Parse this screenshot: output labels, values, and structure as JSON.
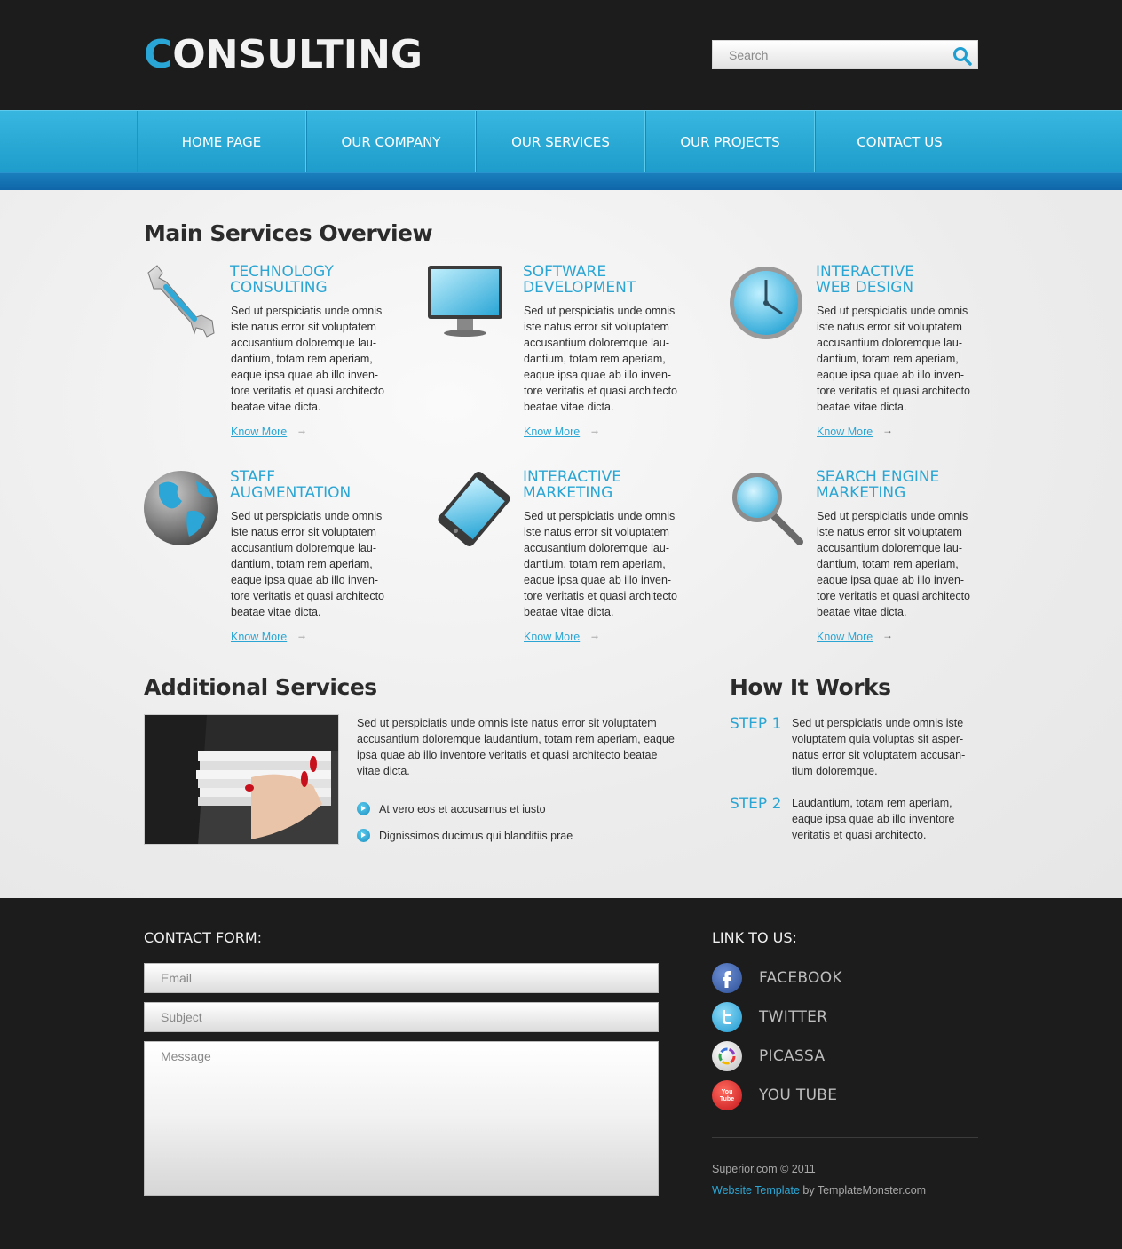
{
  "header": {
    "logo_first": "C",
    "logo_rest": "ONSULTING",
    "search_placeholder": "Search"
  },
  "nav": {
    "items": [
      "HOME PAGE",
      "OUR COMPANY",
      "OUR SERVICES",
      "OUR PROJECTS",
      "CONTACT US"
    ]
  },
  "main_services": {
    "title": "Main Services Overview",
    "know_more": "Know More",
    "arrow": "→",
    "items": [
      {
        "title1": "TECHNOLOGY",
        "title2": "CONSULTING",
        "icon": "wrench-icon"
      },
      {
        "title1": "SOFTWARE",
        "title2": "DEVELOPMENT",
        "icon": "monitor-icon"
      },
      {
        "title1": "INTERACTIVE",
        "title2": "WEB DESIGN",
        "icon": "clock-icon"
      },
      {
        "title1": "STAFF",
        "title2": "AUGMENTATION",
        "icon": "globe-icon"
      },
      {
        "title1": "INTERACTIVE",
        "title2": "MARKETING",
        "icon": "tablet-icon"
      },
      {
        "title1": "SEARCH ENGINE",
        "title2": "MARKETING",
        "icon": "magnifier-icon"
      }
    ],
    "body_lines": [
      "Sed ut perspiciatis unde omnis",
      "iste natus error sit voluptatem",
      "accusantium doloremque lau-",
      "dantium, totam rem aperiam,",
      "eaque ipsa quae ab illo inven-",
      "tore veritatis et quasi architecto",
      "beatae vitae dicta."
    ]
  },
  "additional": {
    "title": "Additional Services",
    "text": "Sed ut perspiciatis unde omnis iste natus error sit voluptatem accusantium doloremque laudantium, totam rem aperiam, eaque ipsa quae ab illo inventore veritatis et quasi architecto beatae vitae dicta.",
    "bullets": [
      "At vero eos et accusamus et iusto",
      "Dignissimos ducimus qui blanditiis prae"
    ]
  },
  "how_it_works": {
    "title": "How It Works",
    "steps": [
      {
        "label": "STEP 1",
        "text": "Sed ut perspiciatis unde omnis iste voluptatem quia voluptas sit asper- natus error sit voluptatem accusan- tium doloremque."
      },
      {
        "label": "STEP 2",
        "text": "Laudantium, totam rem aperiam, eaque ipsa quae ab illo inventore veritatis et quasi architecto."
      }
    ]
  },
  "footer": {
    "contact_title": "CONTACT FORM:",
    "email_placeholder": "Email",
    "subject_placeholder": "Subject",
    "message_placeholder": "Message",
    "links_title": "LINK TO US:",
    "social": [
      {
        "label": "FACEBOOK",
        "icon": "facebook-icon",
        "color": "#3b5ea8"
      },
      {
        "label": "TWITTER",
        "icon": "twitter-icon",
        "color": "#2bb3e6"
      },
      {
        "label": "PICASSA",
        "icon": "picasa-icon",
        "color": "#e8e8e8"
      },
      {
        "label": "YOU TUBE",
        "icon": "youtube-icon",
        "color": "#d32020"
      }
    ],
    "youtube_badge": "You Tube",
    "copyright": "Superior.com © 2011",
    "template_link": "Website Template",
    "by_text": " by TemplateMonster.com"
  },
  "colors": {
    "accent": "#2ba6d4",
    "nav": "#2aa9d8",
    "dark": "#1c1c1c"
  }
}
